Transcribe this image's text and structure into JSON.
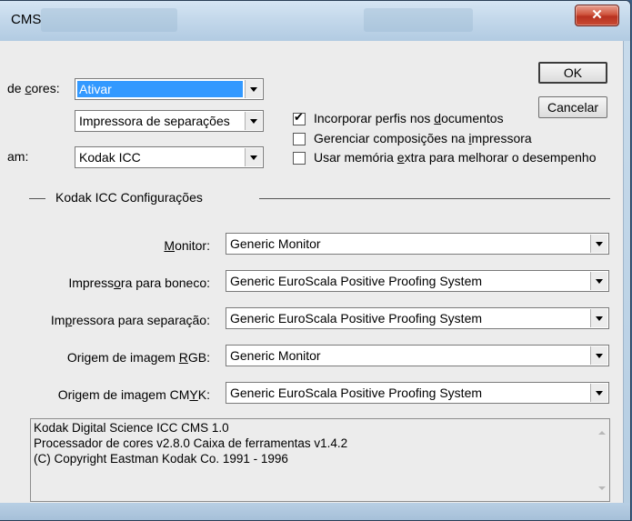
{
  "window": {
    "title": "CMS",
    "close_glyph": "✕"
  },
  "top": {
    "colors_label_pre": "de ",
    "colors_label_ul": "c",
    "colors_label_post": "ores:",
    "colors_value": "Ativar",
    "printer_type_value": "Impressora de separações",
    "engine_label": "am:",
    "engine_value": "Kodak ICC"
  },
  "buttons": {
    "ok": "OK",
    "cancel": "Cancelar"
  },
  "checkboxes": [
    {
      "pre": "Incorporar perfis nos ",
      "ul": "d",
      "post": "ocumentos",
      "checked": true
    },
    {
      "pre": "Gerenciar composições na ",
      "ul": "i",
      "post": "mpressora",
      "checked": false
    },
    {
      "pre": "Usar memória ",
      "ul": "e",
      "post": "xtra para melhorar o desempenho",
      "checked": false
    }
  ],
  "group": {
    "title": "Kodak ICC Configurações"
  },
  "settings": [
    {
      "label_pre": "",
      "label_ul": "M",
      "label_post": "onitor:",
      "value": "Generic Monitor"
    },
    {
      "label_pre": "Impress",
      "label_ul": "o",
      "label_post": "ra para boneco:",
      "value": "Generic EuroScala Positive Proofing System"
    },
    {
      "label_pre": "Im",
      "label_ul": "p",
      "label_post": "ressora para separação:",
      "value": "Generic EuroScala Positive Proofing System"
    },
    {
      "label_pre": "Origem de imagem ",
      "label_ul": "R",
      "label_post": "GB:",
      "value": "Generic Monitor"
    },
    {
      "label_pre": "Origem de imagem CM",
      "label_ul": "Y",
      "label_post": "K:",
      "value": "Generic EuroScala Positive Proofing System"
    }
  ],
  "info": [
    "Kodak Digital Science ICC CMS 1.0",
    "Processador de cores v2.8.0  Caixa de ferramentas v1.4.2",
    " (C) Copyright Eastman Kodak Co.  1991 - 1996"
  ]
}
